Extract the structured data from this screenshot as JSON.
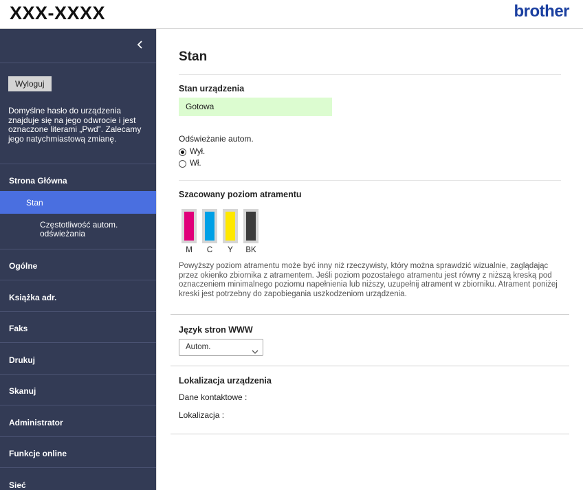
{
  "header": {
    "model": "XXX-XXXX",
    "brand": "brother"
  },
  "sidebar": {
    "collapse_icon": "chevron-left-icon",
    "logout_label": "Wyloguj",
    "password_note": "Domyślne hasło do urządzenia znajduje się na jego odwrocie i jest oznaczone literami „Pwd”. Zalecamy jego natychmiastową zmianę.",
    "home": {
      "label": "Strona Główna",
      "items": [
        {
          "label": "Stan",
          "active": true
        },
        {
          "label": "Częstotliwość autom. odświeżania",
          "active": false
        }
      ]
    },
    "menu": [
      {
        "label": "Ogólne"
      },
      {
        "label": "Książka adr."
      },
      {
        "label": "Faks"
      },
      {
        "label": "Drukuj"
      },
      {
        "label": "Skanuj"
      },
      {
        "label": "Administrator"
      },
      {
        "label": "Funkcje online"
      },
      {
        "label": "Sieć"
      }
    ]
  },
  "main": {
    "title": "Stan",
    "device_status": {
      "title": "Stan urządzenia",
      "value": "Gotowa",
      "color": "#dcfcd0"
    },
    "auto_refresh": {
      "label": "Odświeżanie autom.",
      "options": [
        {
          "label": "Wył.",
          "checked": true
        },
        {
          "label": "Wł.",
          "checked": false
        }
      ]
    },
    "ink": {
      "title": "Szacowany poziom atramentu",
      "cartridges": [
        {
          "label": "M",
          "color": "#e0007a",
          "level": 1.0
        },
        {
          "label": "C",
          "color": "#00a0e6",
          "level": 1.0
        },
        {
          "label": "Y",
          "color": "#ffe800",
          "level": 1.0
        },
        {
          "label": "BK",
          "color": "#3c3c3c",
          "level": 1.0
        }
      ],
      "note": "Powyższy poziom atramentu może być inny niż rzeczywisty, który można sprawdzić wizualnie, zaglądając przez okienko zbiornika z atramentem. Jeśli poziom pozostałego atramentu jest równy z niższą kreską pod oznaczeniem minimalnego poziomu napełnienia lub niższy, uzupełnij atrament w zbiorniku. Atrament poniżej kreski jest potrzebny do zapobiegania uszkodzeniom urządzenia."
    },
    "language": {
      "title": "Język stron WWW",
      "selected": "Autom."
    },
    "location": {
      "title": "Lokalizacja urządzenia",
      "contact_label": "Dane kontaktowe :",
      "location_label": "Lokalizacja :"
    }
  }
}
